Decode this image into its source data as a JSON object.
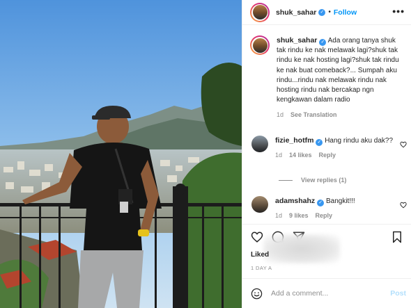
{
  "post": {
    "username": "shuk_sahar",
    "follow_label": "Follow",
    "separator": "•",
    "more_icon": "more-horizontal-icon",
    "verified_icon": "verified-badge-icon"
  },
  "caption": {
    "username": "shuk_sahar",
    "text": "Ada orang tanya shuk tak rindu ke nak melawak lagi?shuk tak rindu ke nak hosting lagi?shuk tak rindu ke nak buat comeback?... Sumpah aku rindu...rindu nak melawak rindu nak hosting rindu nak bercakap ngn kengkawan dalam radio",
    "time": "1d",
    "see_translation": "See Translation"
  },
  "comments": [
    {
      "username": "fizie_hotfm",
      "text": "Hang rindu aku dak??",
      "time": "1d",
      "likes": "14 likes",
      "reply": "Reply",
      "view_replies": "View replies (1)"
    },
    {
      "username": "adamshahz",
      "text": "Bangkit!!!",
      "time": "1d",
      "likes": "9 likes",
      "reply": "Reply"
    }
  ],
  "actions": {
    "likes_prefix": "Liked",
    "date": "1 DAY A",
    "icons": [
      "heart-icon",
      "comment-icon",
      "share-icon",
      "bookmark-icon"
    ]
  },
  "composer": {
    "placeholder": "Add a comment...",
    "post_label": "Post",
    "emoji_icon": "emoji-icon"
  },
  "colors": {
    "link_blue": "#0095f6",
    "verified_blue": "#3897f0",
    "muted_gray": "#8e8e8e",
    "post_disabled": "#b2dffc"
  }
}
